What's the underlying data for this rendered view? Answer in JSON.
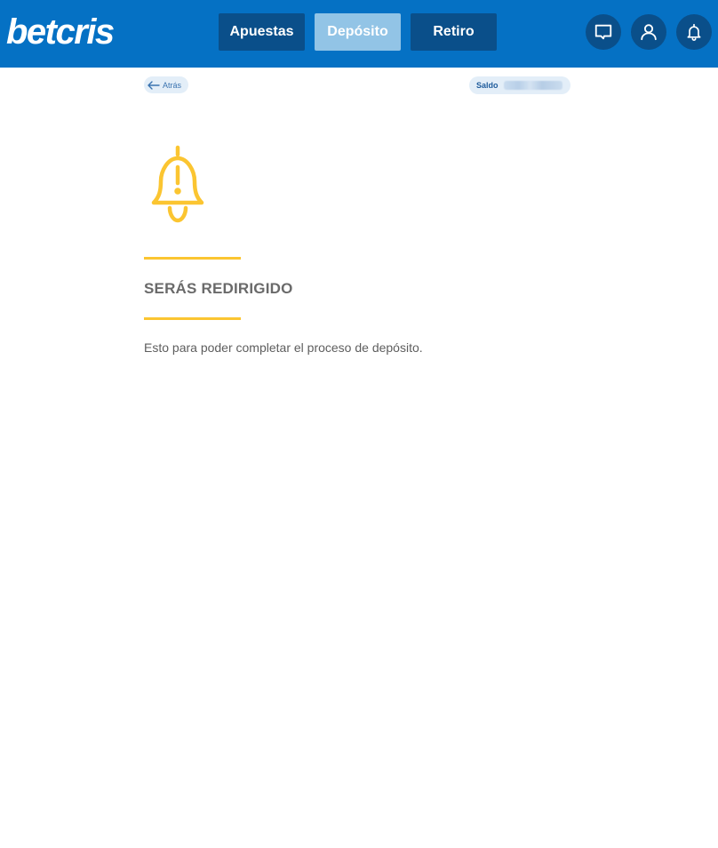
{
  "header": {
    "logo_text": "betcris",
    "nav": {
      "apuestas_label": "Apuestas",
      "deposito_label": "Depósito",
      "retiro_label": "Retiro"
    },
    "icons": [
      "chat-icon",
      "user-icon",
      "bell-icon"
    ]
  },
  "subheader": {
    "back_label": "Atrás",
    "saldo_label": "Saldo"
  },
  "content": {
    "icon": "alert-bell-icon",
    "heading": "SERÁS REDIRIGIDO",
    "message": "Esto para poder completar el proceso de depósito."
  },
  "colors": {
    "brand_blue": "#0571c4",
    "nav_dark": "#0a4f8a",
    "nav_active": "#92c4e6",
    "accent_yellow": "#fbc531"
  }
}
